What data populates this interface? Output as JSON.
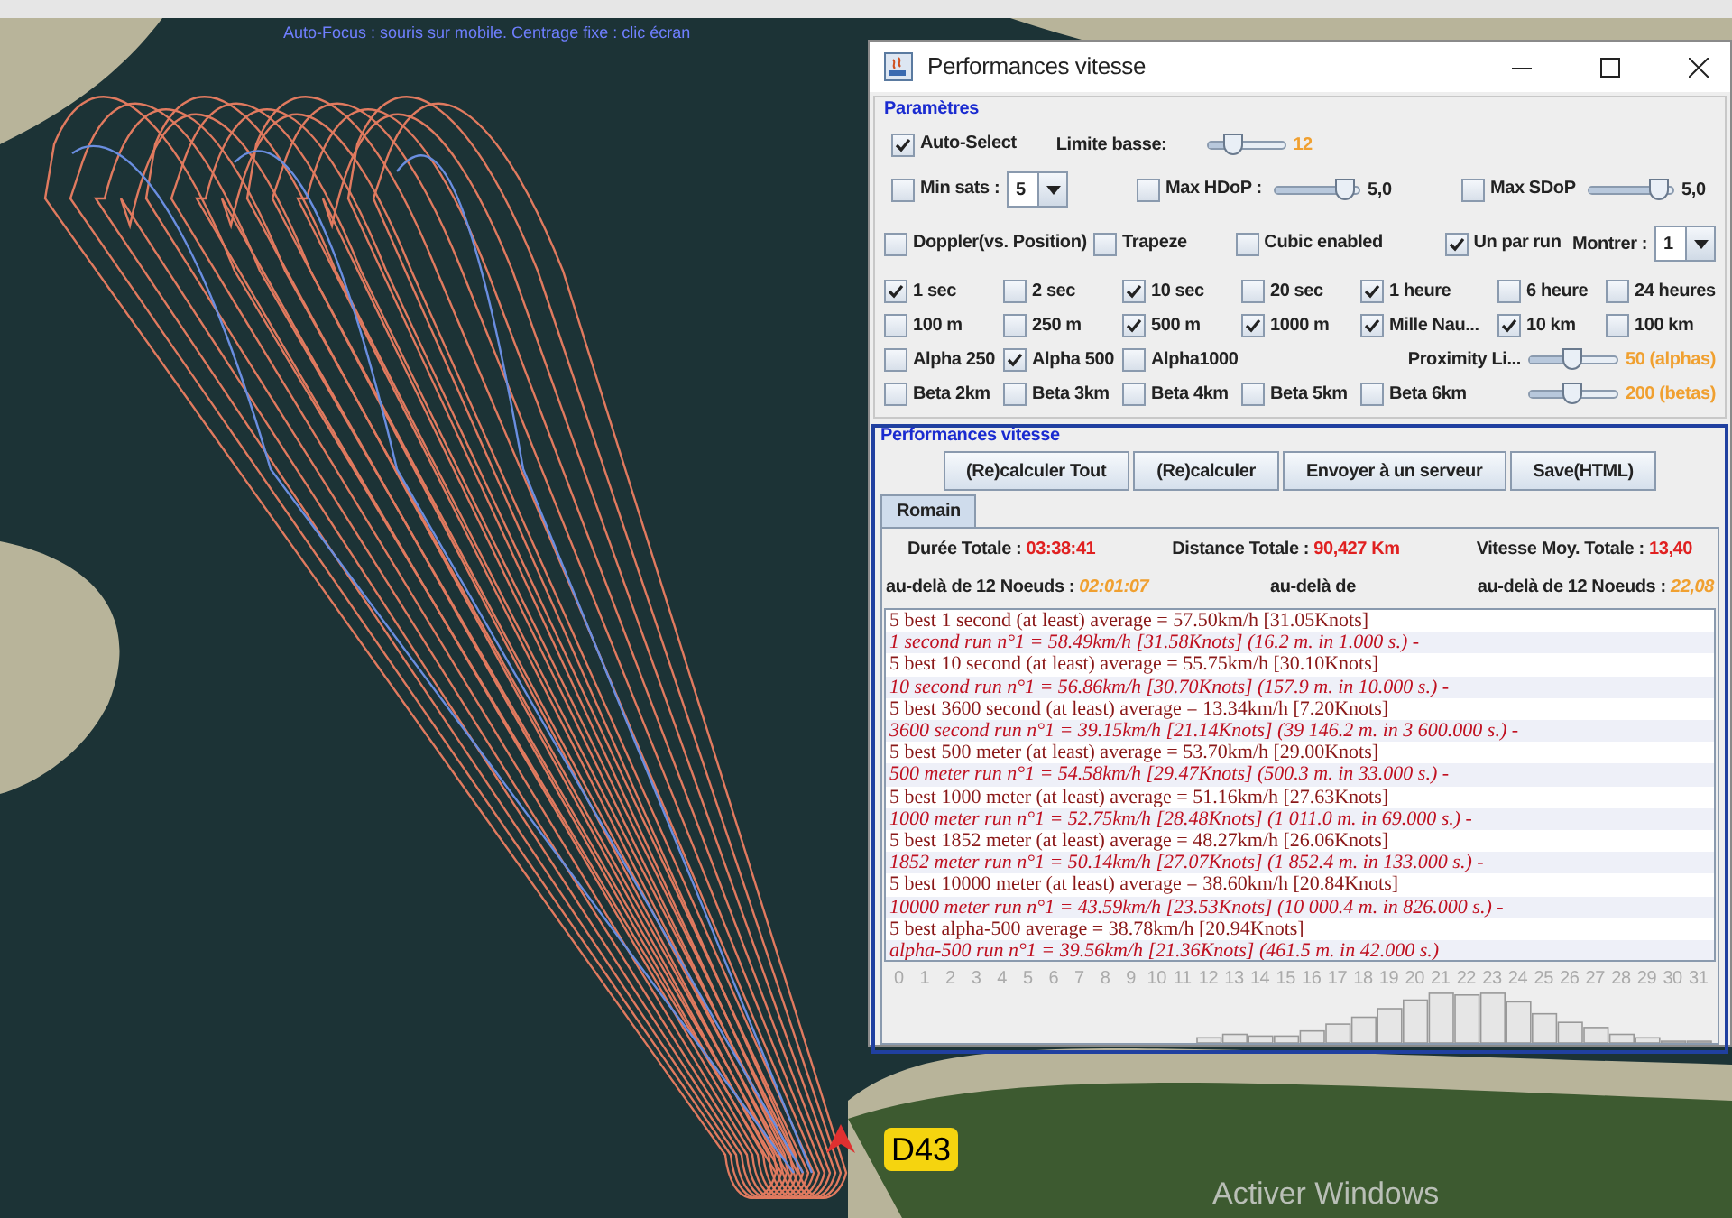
{
  "map": {
    "hint": "Auto-Focus : souris sur mobile. Centrage fixe : clic écran",
    "road_label": "D43",
    "watermark": "Activer Windows"
  },
  "window": {
    "title": "Performances vitesse"
  },
  "parametres": {
    "title": "Paramètres",
    "auto_controls": [
      {
        "kind": "checkbox",
        "label": "Auto-Select",
        "checked": true
      },
      {
        "kind": "label",
        "text": "Limite basse:"
      },
      {
        "kind": "limit",
        "level": 0.35,
        "value": "12"
      }
    ],
    "filter_controls": [
      {
        "kind": "checkbox",
        "label": "Min sats :",
        "checked": false
      },
      {
        "kind": "combo",
        "value": "5"
      },
      {
        "kind": "checkbox",
        "label": "Max HDoP :",
        "checked": false
      },
      {
        "kind": "slider",
        "level": 0.85,
        "value": "5,0"
      },
      {
        "kind": "checkbox",
        "label": "Max SDoP",
        "checked": false
      },
      {
        "kind": "slider",
        "level": 0.85,
        "value": "5,0"
      }
    ],
    "option_controls": [
      {
        "kind": "checkbox",
        "label": "Doppler(vs. Position)",
        "checked": false
      },
      {
        "kind": "checkbox",
        "label": "Trapeze",
        "checked": false
      },
      {
        "kind": "checkbox",
        "label": "Cubic enabled",
        "checked": false
      },
      {
        "kind": "checkbox",
        "label": "Un par run",
        "checked": true
      },
      {
        "kind": "label",
        "text": "Montrer :"
      },
      {
        "kind": "combo",
        "value": "1"
      }
    ],
    "grid": [
      [
        {
          "kind": "checkbox",
          "label": "1 sec",
          "checked": true
        },
        {
          "kind": "checkbox",
          "label": "2 sec",
          "checked": false
        },
        {
          "kind": "checkbox",
          "label": "10 sec",
          "checked": true
        },
        {
          "kind": "checkbox",
          "label": "20 sec",
          "checked": false
        },
        {
          "kind": "checkbox",
          "label": "1 heure",
          "checked": true
        },
        {
          "kind": "checkbox",
          "label": "6 heure",
          "checked": false
        },
        {
          "kind": "checkbox",
          "label": "24 heures",
          "checked": false
        }
      ],
      [
        {
          "kind": "checkbox",
          "label": "100 m",
          "checked": false
        },
        {
          "kind": "checkbox",
          "label": "250 m",
          "checked": false
        },
        {
          "kind": "checkbox",
          "label": "500 m",
          "checked": true
        },
        {
          "kind": "checkbox",
          "label": "1000 m",
          "checked": true
        },
        {
          "kind": "checkbox",
          "label": "Mille Nau...",
          "checked": true
        },
        {
          "kind": "checkbox",
          "label": "10 km",
          "checked": true
        },
        {
          "kind": "checkbox",
          "label": "100 km",
          "checked": false
        }
      ],
      [
        {
          "kind": "checkbox",
          "label": "Alpha 250",
          "checked": false
        },
        {
          "kind": "checkbox",
          "label": "Alpha 500",
          "checked": true
        },
        {
          "kind": "checkbox",
          "label": "Alpha1000",
          "checked": false
        },
        {
          "kind": "label",
          "text": "Proximity Li..."
        },
        {
          "kind": "limit",
          "level": 0.5,
          "value": "50 (alphas)"
        }
      ],
      [
        {
          "kind": "checkbox",
          "label": "Beta 2km",
          "checked": false
        },
        {
          "kind": "checkbox",
          "label": "Beta 3km",
          "checked": false
        },
        {
          "kind": "checkbox",
          "label": "Beta 4km",
          "checked": false
        },
        {
          "kind": "checkbox",
          "label": "Beta 5km",
          "checked": false
        },
        {
          "kind": "checkbox",
          "label": "Beta 6km",
          "checked": false
        },
        {
          "kind": "limit",
          "level": 0.5,
          "value": "200 (betas)"
        }
      ]
    ]
  },
  "performances": {
    "title": "Performances vitesse",
    "buttons": [
      "(Re)calculer Tout",
      "(Re)calculer",
      "Envoyer à un serveur",
      "Save(HTML)"
    ],
    "tabs": [
      {
        "label": "Romain",
        "selected": true
      }
    ],
    "stats": [
      [
        {
          "label": "Durée Totale :",
          "value": "03:38:41"
        },
        {
          "label": "Distance Totale :",
          "value": "90,427 Km"
        },
        {
          "label": "Vitesse Moy. Totale :",
          "value": "13,40"
        }
      ],
      [
        {
          "label": "au-delà de 12 Noeuds :",
          "value": "02:01:07"
        },
        {
          "label": "au-delà de"
        },
        {
          "label": "au-delà de 12 Noeuds :",
          "value": "22,08"
        }
      ]
    ],
    "results": [
      {
        "kind": "summary",
        "text": "5 best 1 second (at least) average = 57.50km/h [31.05Knots]"
      },
      {
        "kind": "run",
        "text": "1 second run n°1 = 58.49km/h [31.58Knots] (16.2 m. in 1.000 s.) -"
      },
      {
        "kind": "summary",
        "text": "5 best 10 second (at least) average = 55.75km/h [30.10Knots]"
      },
      {
        "kind": "run",
        "text": "10 second run n°1 = 56.86km/h [30.70Knots] (157.9 m. in 10.000 s.) -"
      },
      {
        "kind": "summary",
        "text": "5 best 3600 second (at least) average = 13.34km/h [7.20Knots]"
      },
      {
        "kind": "run",
        "text": "3600 second run n°1 = 39.15km/h [21.14Knots] (39 146.2 m. in 3 600.000 s.) -"
      },
      {
        "kind": "summary",
        "text": "5 best 500 meter (at least) average = 53.70km/h [29.00Knots]"
      },
      {
        "kind": "run",
        "text": "500 meter run n°1 = 54.58km/h [29.47Knots] (500.3 m. in 33.000 s.) -"
      },
      {
        "kind": "summary",
        "text": "5 best 1000 meter (at least) average = 51.16km/h [27.63Knots]"
      },
      {
        "kind": "run",
        "text": "1000 meter run n°1 = 52.75km/h [28.48Knots] (1 011.0 m. in 69.000 s.) -"
      },
      {
        "kind": "summary",
        "text": "5 best 1852 meter (at least) average = 48.27km/h [26.06Knots]"
      },
      {
        "kind": "run",
        "text": "1852 meter run n°1 = 50.14km/h [27.07Knots] (1 852.4 m. in 133.000 s.) -"
      },
      {
        "kind": "summary",
        "text": "5 best 10000 meter (at least) average = 38.60km/h [20.84Knots]"
      },
      {
        "kind": "run",
        "text": "10000 meter run n°1 = 43.59km/h [23.53Knots] (10 000.4 m. in 826.000 s.) -"
      },
      {
        "kind": "summary",
        "text": "5 best alpha-500 average = 38.78km/h [20.94Knots]"
      },
      {
        "kind": "run",
        "text": "alpha-500 run n°1 = 39.56km/h [21.36Knots] (461.5 m. in 42.000 s.)"
      }
    ],
    "histogram_labels": [
      "0",
      "1",
      "2",
      "3",
      "4",
      "5",
      "6",
      "7",
      "8",
      "9",
      "10",
      "11",
      "12",
      "13",
      "14",
      "15",
      "16",
      "17",
      "18",
      "19",
      "20",
      "21",
      "22",
      "23",
      "24",
      "25",
      "26",
      "27",
      "28",
      "29",
      "30",
      "31"
    ]
  }
}
